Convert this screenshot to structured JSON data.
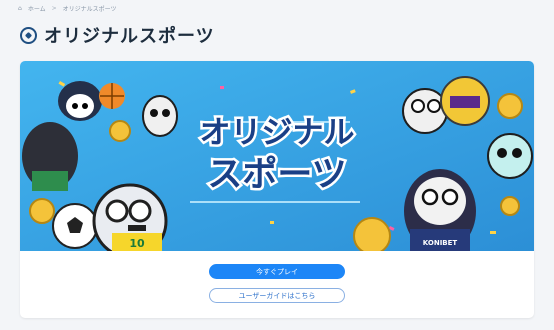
{
  "breadcrumb": {
    "home": "ホーム",
    "separator": ">",
    "current": "オリジナルスポーツ"
  },
  "page": {
    "title": "オリジナルスポーツ"
  },
  "banner": {
    "line1": "オリジナル",
    "line2": "スポーツ",
    "jersey_number": "10",
    "brand": "KONIBET"
  },
  "actions": {
    "play_now": "今すぐプレイ",
    "user_guide": "ユーザーガイドはこちら"
  },
  "colors": {
    "accent": "#1d86f7",
    "banner_bg": "#36a7e8",
    "title_text": "#1a3f86"
  }
}
